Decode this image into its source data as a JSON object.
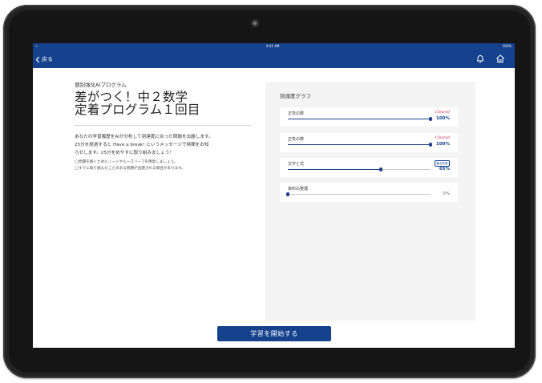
{
  "status_bar": {
    "carrier": "•",
    "time": "9:41 AM",
    "battery": "100%"
  },
  "nav": {
    "back_label": "戻る",
    "icons": [
      "bell-icon",
      "home-icon"
    ]
  },
  "left": {
    "program_label": "個別強化AIプログラム",
    "title_line1": "差がつく！中２数学",
    "title_line2": "定着プログラム１回目",
    "description": [
      "あなたの学習履歴をAIが分析して到達度に合った問題を出題します。",
      "25分を経過すると Have a break! というメッセージで時間をお知",
      "らせします。25分をめやすに取り組みましょう！"
    ],
    "notes": [
      "◯問題を解くためにノートやルーズリーフを用意しましょう。",
      "◯すでに取り組んだことのある問題が出題される場合があります。"
    ]
  },
  "graph": {
    "title": "到達度グラフ",
    "items": [
      {
        "label": "正負の数",
        "badge": "Cleared",
        "badge_type": "cleared",
        "percent": "100%",
        "value": 1.0
      },
      {
        "label": "正負の数",
        "badge": "Cleared",
        "badge_type": "cleared",
        "percent": "100%",
        "value": 1.0
      },
      {
        "label": "文字と式",
        "badge": "重点学習",
        "badge_type": "box",
        "percent": "65%",
        "value": 0.65
      },
      {
        "label": "資料の整理",
        "badge": "",
        "badge_type": "none",
        "percent": "0%",
        "value": 0.0
      }
    ]
  },
  "start_button": "学習を開始する",
  "colors": {
    "primary": "#16418d",
    "cleared": "#d0284b",
    "panel": "#f4f4f4"
  }
}
